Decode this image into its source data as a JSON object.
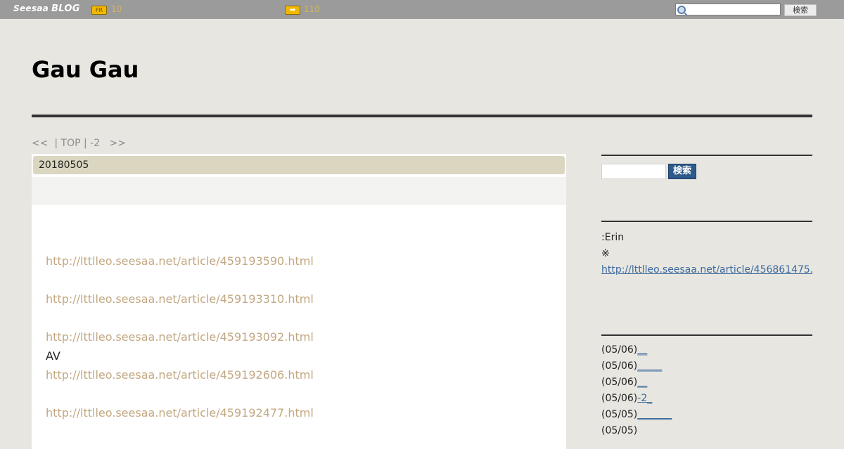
{
  "topbar": {
    "logo_seesaa": "Seesaa",
    "logo_blog": "BLOG",
    "badge_fr": "FR",
    "fr_count": "10",
    "arrow_count": "110",
    "search_button": "検索"
  },
  "blog": {
    "title": "Gau Gau"
  },
  "pager": {
    "text": "<<  | TOP | -2   >>"
  },
  "article": {
    "date": "20180505",
    "entries": [
      {
        "label": "",
        "url": "http://lttlleo.seesaa.net/article/459193590.html"
      },
      {
        "label": "",
        "url": "http://lttlleo.seesaa.net/article/459193310.html"
      },
      {
        "label": "",
        "url": "http://lttlleo.seesaa.net/article/459193092.html"
      },
      {
        "label": "AV",
        "url": "http://lttlleo.seesaa.net/article/459192606.html"
      },
      {
        "label": "",
        "url": "http://lttlleo.seesaa.net/article/459192477.html"
      }
    ]
  },
  "sidebar": {
    "search_button": "検索",
    "profile_name": ":Erin",
    "profile_note": "※",
    "profile_link": "http://lttlleo.seesaa.net/article/456861475.",
    "recent": [
      {
        "date": "(05/06)",
        "title": "__"
      },
      {
        "date": "(05/06)",
        "title": "_____"
      },
      {
        "date": "(05/06)",
        "title": "__"
      },
      {
        "date": "(05/06)",
        "title": "-2_"
      },
      {
        "date": "(05/05)",
        "title": "_______"
      },
      {
        "date": "(05/05)",
        "title": ""
      }
    ]
  },
  "colors": {
    "topbar": "#9b9b9b",
    "page_bg": "#e7e6e1",
    "date_bar": "#dbd6c0",
    "entry_link": "#c2a882",
    "sidebar_link": "#3c6a9c",
    "search_button": "#2e5a8a"
  }
}
